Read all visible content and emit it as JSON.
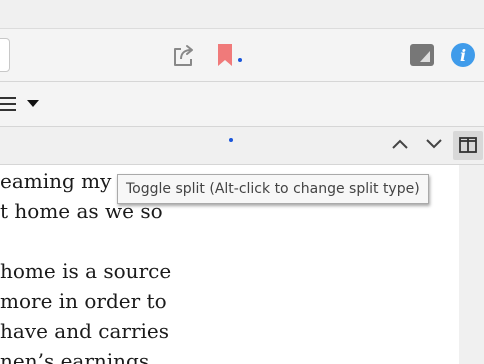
{
  "icons": {
    "share": "share-icon",
    "bookmark": "bookmark-icon",
    "reader_mode": "reader-mode-icon",
    "info": "info-icon",
    "menu": "hamburger-menu-icon",
    "dropdown": "caret-down-icon",
    "find_previous": "chevron-up-icon",
    "find_next": "chevron-down-icon",
    "split": "split-view-icon"
  },
  "colors": {
    "bookmark": "#f07a7a",
    "info": "#3f9bea",
    "indicator_dot": "#1a56db",
    "icon_gray": "#777777"
  },
  "info_glyph": "i",
  "document": {
    "lines": [
      "eaming my",
      "t home as we so",
      "",
      " home is a source",
      "more in order to",
      " have and carries",
      "nen’s earnings"
    ]
  },
  "tooltip": {
    "text": "Toggle split (Alt-click to change split type)"
  }
}
